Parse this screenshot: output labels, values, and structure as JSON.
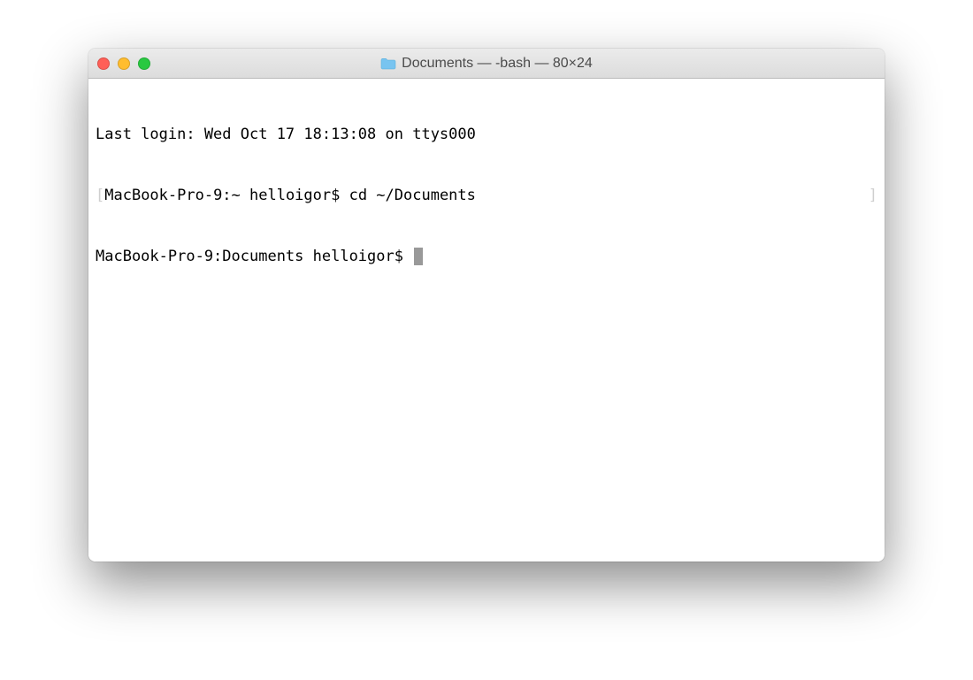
{
  "window": {
    "title": "Documents — -bash — 80×24"
  },
  "terminal": {
    "last_login": "Last login: Wed Oct 17 18:13:08 on ttys000",
    "line1_prompt": "MacBook-Pro-9:~ helloigor$ ",
    "line1_command": "cd ~/Documents",
    "line2_prompt": "MacBook-Pro-9:Documents helloigor$ ",
    "bracket_left": "[",
    "bracket_right": "]"
  }
}
